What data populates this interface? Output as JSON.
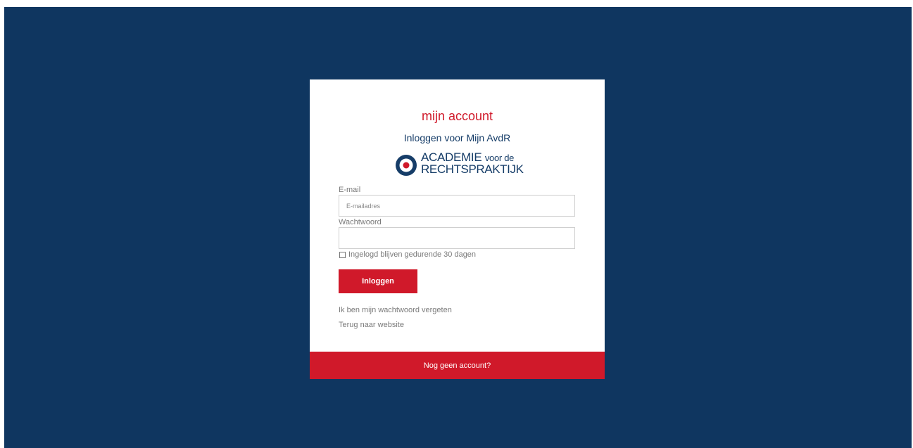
{
  "colors": {
    "background": "#0f3660",
    "accent": "#d0192a",
    "brand_navy": "#163d68"
  },
  "card": {
    "title": "mijn account",
    "subtitle": "Inloggen voor Mijn AvdR"
  },
  "logo": {
    "icon": "target-logo-icon",
    "line1_main": "ACADEMIE",
    "line1_small": "voor de",
    "line2": "RECHTSPRAKTIJK"
  },
  "form": {
    "email_label": "E-mail",
    "email_placeholder": "E-mailadres",
    "email_value": "",
    "password_label": "Wachtwoord",
    "password_value": "",
    "remember_label": "Ingelogd blijven gedurende 30 dagen",
    "remember_checked": false,
    "login_button": "Inloggen"
  },
  "links": {
    "forgot_password": "Ik ben mijn wachtwoord vergeten",
    "back_to_website": "Terug naar website"
  },
  "footer": {
    "label": "Nog geen account?"
  }
}
